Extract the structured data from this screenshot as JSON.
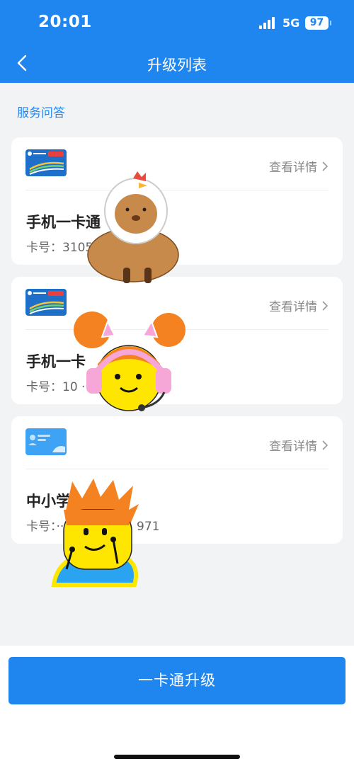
{
  "status_bar": {
    "time": "20:01",
    "network": "5G",
    "battery": "97"
  },
  "nav": {
    "title": "升级列表"
  },
  "faq_link": "服务问答",
  "cards": [
    {
      "detail_label": "查看详情",
      "name": "手机一卡通",
      "number_label": "卡号：",
      "number": "3105 ···· 5 346",
      "logo_text": "一卡通"
    },
    {
      "detail_label": "查看详情",
      "name": "手机一卡",
      "number_label": "卡号：",
      "number": "10 ···· 33",
      "logo_text": "一卡通"
    },
    {
      "detail_label": "查看详情",
      "name": "中小学",
      "number_label": "卡号：",
      "number": "···· 015 8815 971",
      "logo_text": ""
    }
  ],
  "upgrade_button": "一卡通升级",
  "colors": {
    "brand": "#1f86f0",
    "background": "#f2f3f5",
    "card": "#ffffff"
  },
  "icons": [
    "back-arrow-icon",
    "chevron-right-icon",
    "signal-icon",
    "battery-icon"
  ]
}
